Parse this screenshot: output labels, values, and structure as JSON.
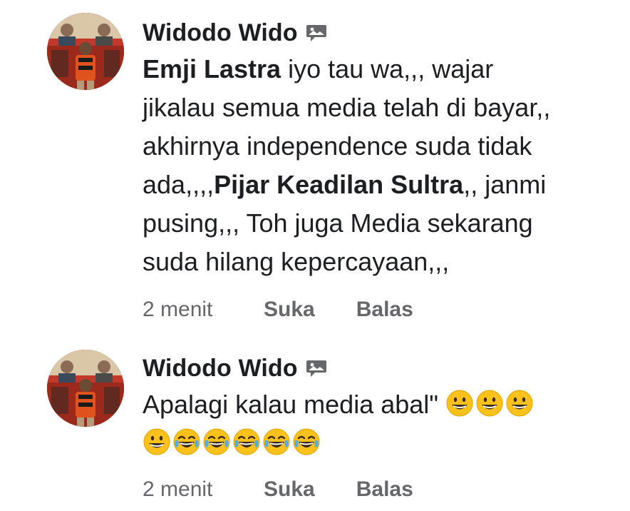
{
  "comments": [
    {
      "author": "Widodo Wido",
      "badge_icon": "photo-chat-icon",
      "lines": [
        {
          "segments": [
            {
              "text": "Emji Lastra",
              "bold": true
            },
            {
              "text": " iyo tau wa,,, wajar",
              "bold": false
            }
          ]
        },
        {
          "segments": [
            {
              "text": "jikalau semua media telah di bayar,,",
              "bold": false
            }
          ]
        },
        {
          "segments": [
            {
              "text": "akhirnya independence suda tidak",
              "bold": false
            }
          ]
        },
        {
          "segments": [
            {
              "text": "ada,,,,",
              "bold": false
            },
            {
              "text": "Pijar Keadilan Sultra",
              "bold": true
            },
            {
              "text": ",, janmi",
              "bold": false
            }
          ]
        },
        {
          "segments": [
            {
              "text": "pusing,,, Toh juga Media sekarang",
              "bold": false
            }
          ]
        },
        {
          "segments": [
            {
              "text": "suda hilang kepercayaan,,,",
              "bold": false
            }
          ]
        }
      ],
      "time": "2 menit",
      "like_label": "Suka",
      "reply_label": "Balas"
    },
    {
      "author": "Widodo Wido",
      "badge_icon": "photo-chat-icon",
      "lines": [
        {
          "segments": [
            {
              "text": "Apalagi kalau media abal\"",
              "bold": false
            }
          ],
          "emojis": [
            "grinning-face",
            "grinning-face",
            "grinning-face"
          ]
        },
        {
          "segments": [],
          "emojis": [
            "grinning-face",
            "tears-of-joy-face",
            "tears-of-joy-face",
            "tears-of-joy-face",
            "tears-of-joy-face",
            "tears-of-joy-face"
          ]
        }
      ],
      "time": "2 menit",
      "like_label": "Suka",
      "reply_label": "Balas"
    }
  ]
}
